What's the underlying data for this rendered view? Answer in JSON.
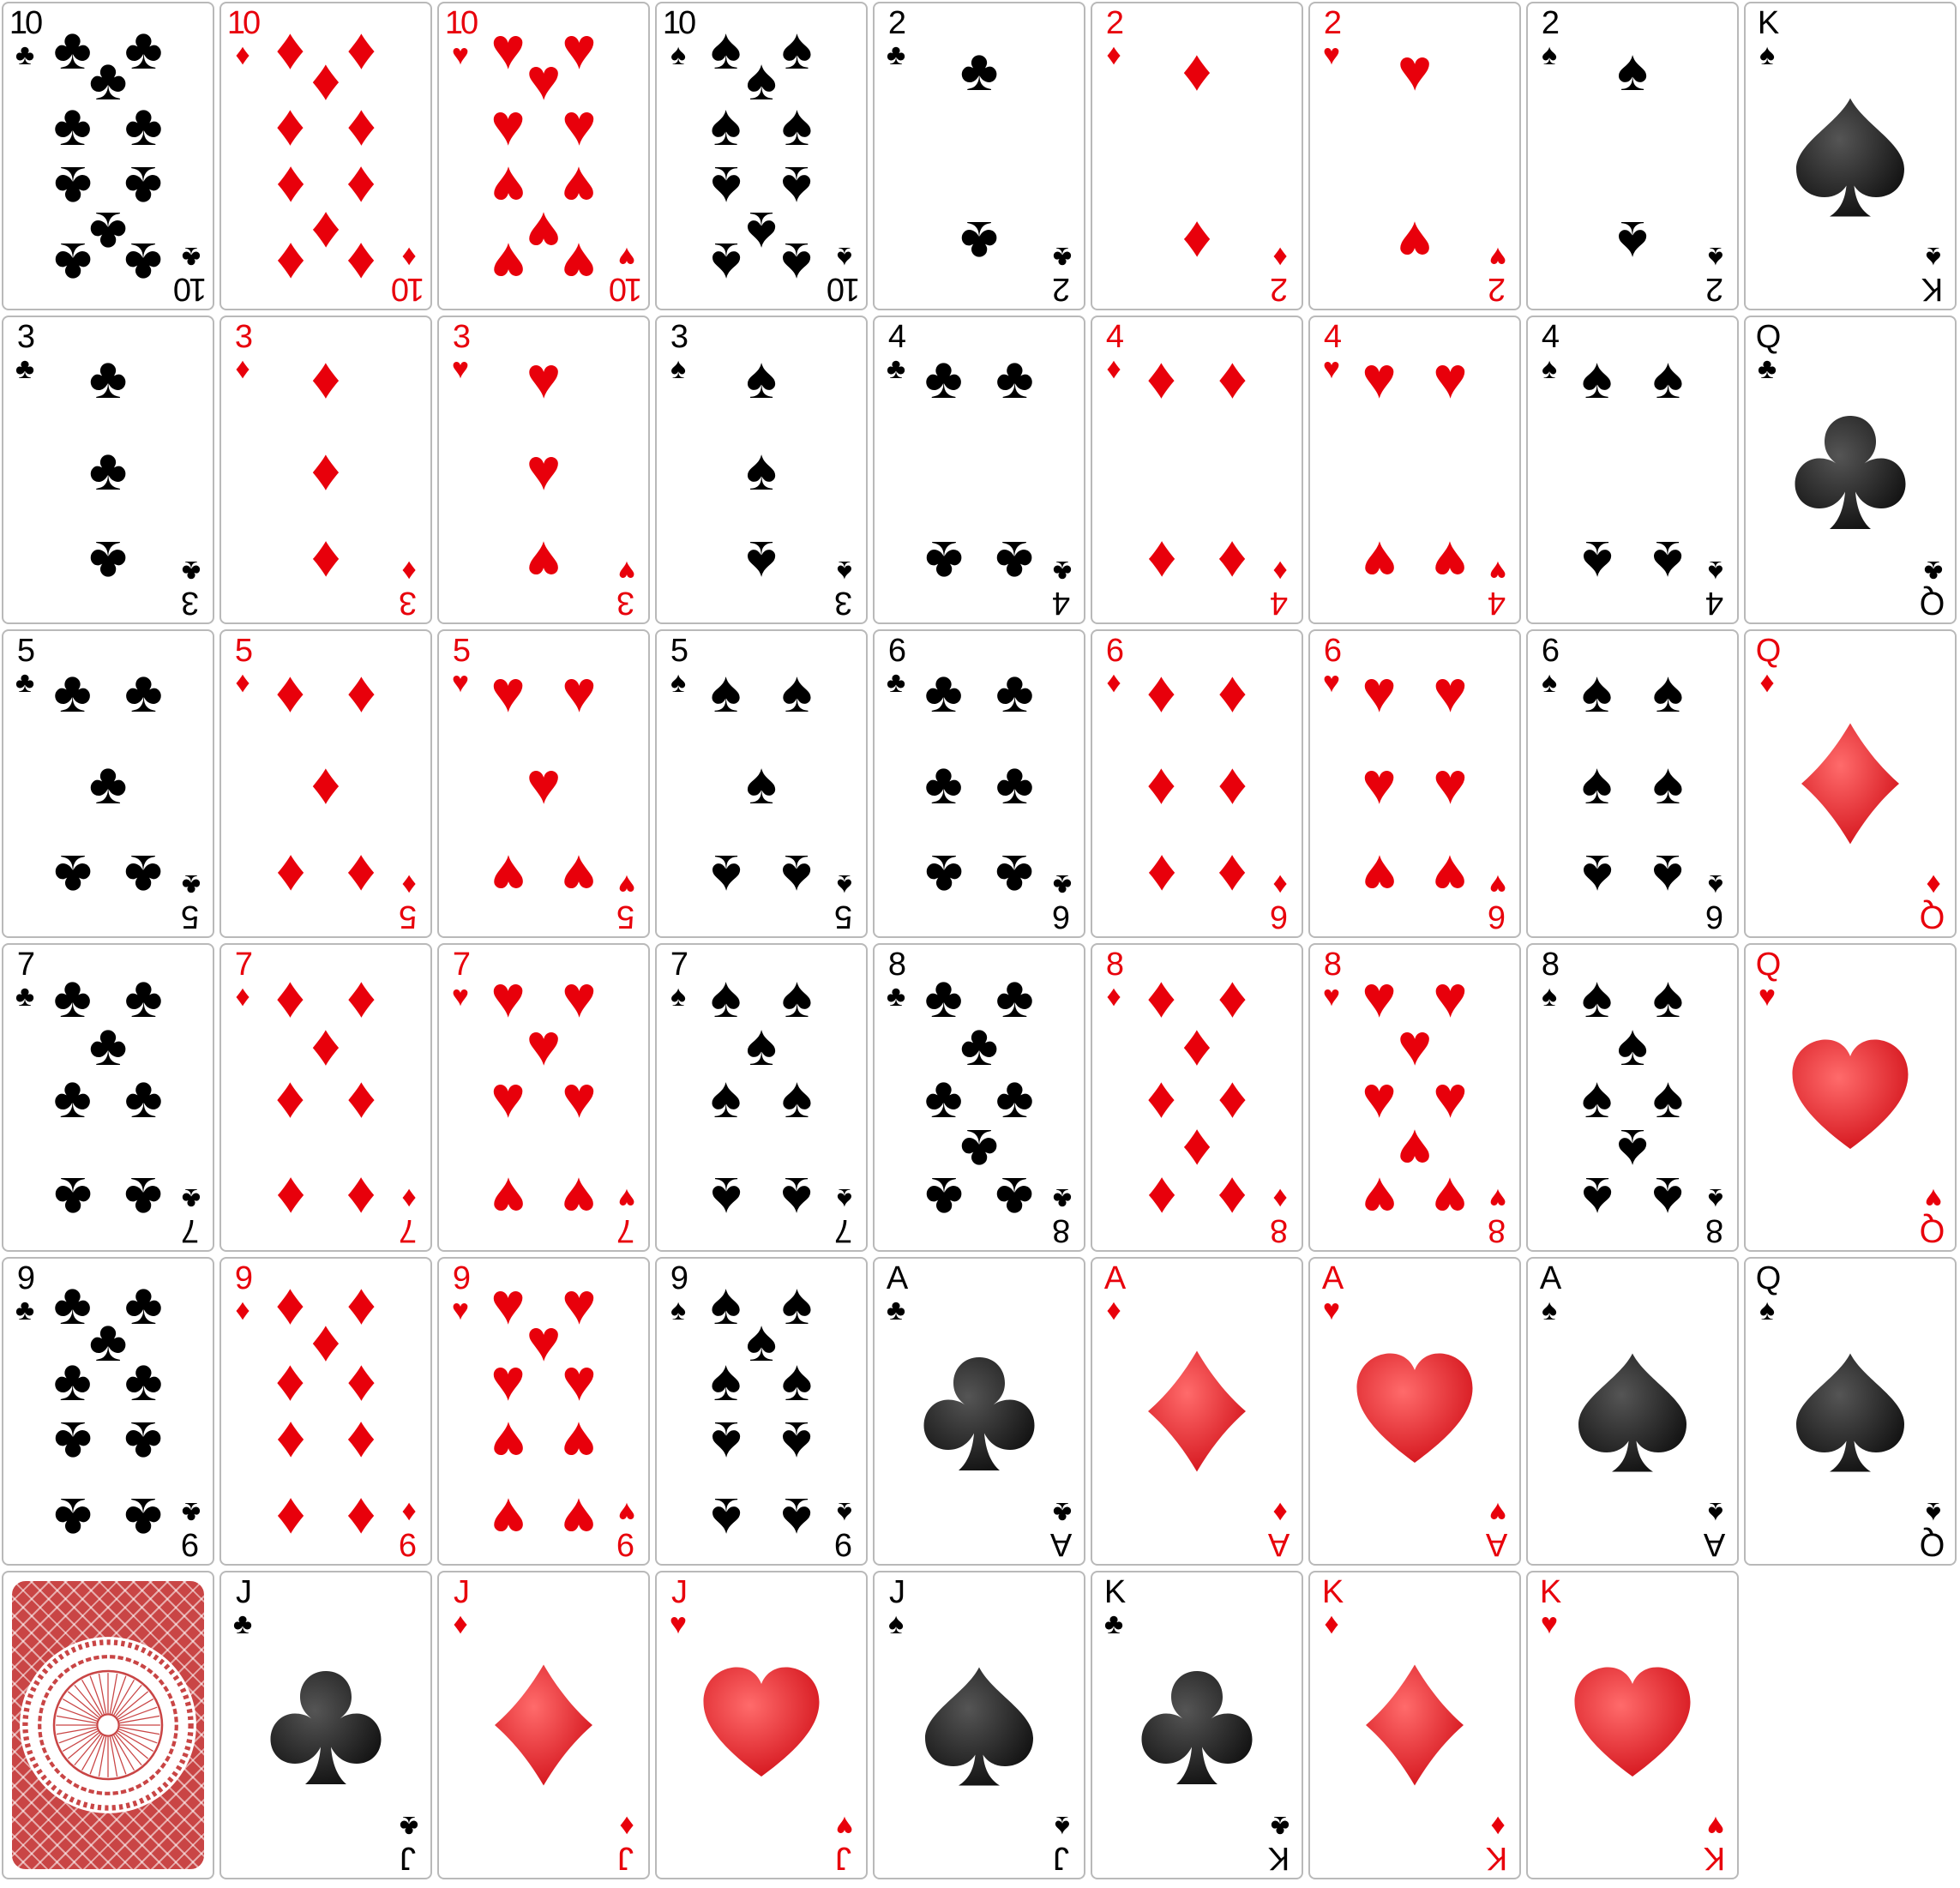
{
  "colors": {
    "red": "#e8000b",
    "black": "#000000",
    "border": "#b9b9b9",
    "back": "#c94545"
  },
  "suits": {
    "C": {
      "glyph": "♣",
      "name": "clubs",
      "color": "black"
    },
    "D": {
      "glyph": "♦",
      "name": "diamonds",
      "color": "red"
    },
    "H": {
      "glyph": "♥",
      "name": "hearts",
      "color": "red"
    },
    "S": {
      "glyph": "♠",
      "name": "spades",
      "color": "black"
    }
  },
  "cards": [
    {
      "rank": "10",
      "suit": "C"
    },
    {
      "rank": "10",
      "suit": "D"
    },
    {
      "rank": "10",
      "suit": "H"
    },
    {
      "rank": "10",
      "suit": "S"
    },
    {
      "rank": "2",
      "suit": "C"
    },
    {
      "rank": "2",
      "suit": "D"
    },
    {
      "rank": "2",
      "suit": "H"
    },
    {
      "rank": "2",
      "suit": "S"
    },
    {
      "rank": "K",
      "suit": "S"
    },
    {
      "rank": "3",
      "suit": "C"
    },
    {
      "rank": "3",
      "suit": "D"
    },
    {
      "rank": "3",
      "suit": "H"
    },
    {
      "rank": "3",
      "suit": "S"
    },
    {
      "rank": "4",
      "suit": "C"
    },
    {
      "rank": "4",
      "suit": "D"
    },
    {
      "rank": "4",
      "suit": "H"
    },
    {
      "rank": "4",
      "suit": "S"
    },
    {
      "rank": "Q",
      "suit": "C"
    },
    {
      "rank": "5",
      "suit": "C"
    },
    {
      "rank": "5",
      "suit": "D"
    },
    {
      "rank": "5",
      "suit": "H"
    },
    {
      "rank": "5",
      "suit": "S"
    },
    {
      "rank": "6",
      "suit": "C"
    },
    {
      "rank": "6",
      "suit": "D"
    },
    {
      "rank": "6",
      "suit": "H"
    },
    {
      "rank": "6",
      "suit": "S"
    },
    {
      "rank": "Q",
      "suit": "D"
    },
    {
      "rank": "7",
      "suit": "C"
    },
    {
      "rank": "7",
      "suit": "D"
    },
    {
      "rank": "7",
      "suit": "H"
    },
    {
      "rank": "7",
      "suit": "S"
    },
    {
      "rank": "8",
      "suit": "C"
    },
    {
      "rank": "8",
      "suit": "D"
    },
    {
      "rank": "8",
      "suit": "H"
    },
    {
      "rank": "8",
      "suit": "S"
    },
    {
      "rank": "Q",
      "suit": "H"
    },
    {
      "rank": "9",
      "suit": "C"
    },
    {
      "rank": "9",
      "suit": "D"
    },
    {
      "rank": "9",
      "suit": "H"
    },
    {
      "rank": "9",
      "suit": "S"
    },
    {
      "rank": "A",
      "suit": "C"
    },
    {
      "rank": "A",
      "suit": "D"
    },
    {
      "rank": "A",
      "suit": "H"
    },
    {
      "rank": "A",
      "suit": "S"
    },
    {
      "rank": "Q",
      "suit": "S"
    },
    {
      "rank": "",
      "suit": "",
      "back": true
    },
    {
      "rank": "J",
      "suit": "C"
    },
    {
      "rank": "J",
      "suit": "D"
    },
    {
      "rank": "J",
      "suit": "H"
    },
    {
      "rank": "J",
      "suit": "S"
    },
    {
      "rank": "K",
      "suit": "C"
    },
    {
      "rank": "K",
      "suit": "D"
    },
    {
      "rank": "K",
      "suit": "H"
    }
  ]
}
